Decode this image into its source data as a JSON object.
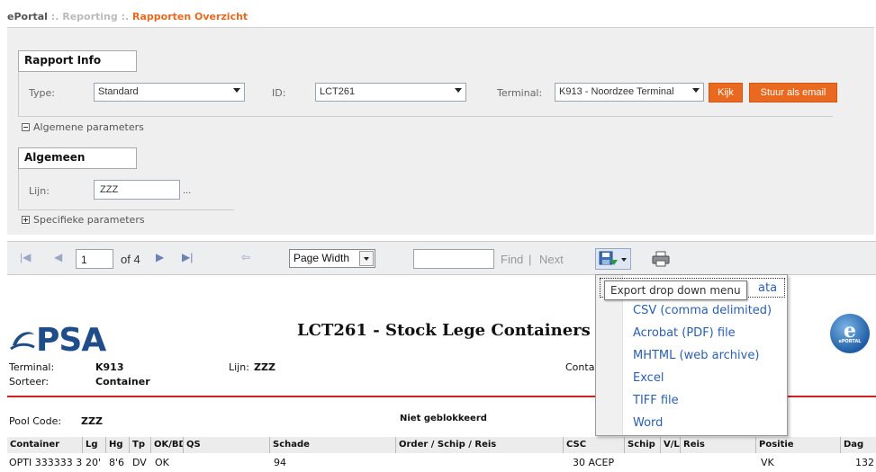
{
  "breadcrumb": {
    "home": "ePortal",
    "sep1": " :. ",
    "mid": "Reporting",
    "sep2": " :. ",
    "current": "Rapporten Overzicht"
  },
  "rapport_info": {
    "title": "Rapport Info",
    "type_label": "Type:",
    "type_value": "Standard",
    "id_label": "ID:",
    "id_value": "LCT261",
    "terminal_label": "Terminal:",
    "terminal_value": "K913 - Noordzee Terminal",
    "kijk_label": "Kijk",
    "email_label": "Stuur als email"
  },
  "algemene_toggle": "Algemene parameters",
  "algemeen": {
    "title": "Algemeen",
    "lijn_label": "Lijn:",
    "lijn_value": "ZZZ",
    "ellipsis": "..."
  },
  "specifieke_toggle": "Specifieke parameters",
  "toolbar": {
    "page_value": "1",
    "of_pages": "of 4",
    "zoom": "Page Width",
    "find_label": "Find",
    "sep": "|",
    "next_label": "Next"
  },
  "export_menu": {
    "tooltip": "Export drop down menu",
    "hidden_item_tail": "ata",
    "items": [
      "CSV (comma delimited)",
      "Acrobat (PDF) file",
      "MHTML (web archive)",
      "Excel",
      "TIFF file",
      "Word"
    ]
  },
  "report": {
    "logo_text": "PSA",
    "title": "LCT261  -  Stock Lege Containers",
    "eportal_logo_text": "e",
    "eportal_logo_sub": "ePORTAL",
    "terminal_label": "Terminal:",
    "terminal_value": "K913",
    "sorteer_label": "Sorteer:",
    "sorteer_value": "Container",
    "lijn_label": "Lijn:",
    "lijn_value": "ZZZ",
    "conta_label": "Conta",
    "pool_label": "Pool Code:",
    "pool_value": "ZZZ",
    "status": "Niet geblokkeerd"
  },
  "table": {
    "columns": [
      "Container",
      "Lg",
      "Hg",
      "Tp",
      "OK/BD",
      "QS",
      "Schade",
      "Order / Schip / Reis",
      "CSC",
      "Schip",
      "V/L",
      "Reis",
      "Positie",
      "Dag"
    ],
    "row": [
      "OPTI 333333 3",
      "20'",
      "8'6",
      "DV",
      "OK",
      "",
      "94",
      "",
      "30 ACEP",
      "",
      "",
      "",
      "VK",
      "132"
    ]
  },
  "colors": {
    "accent": "#e8691f",
    "link": "#2a5fb0",
    "brand": "#1f4d8a",
    "rule": "#d02020"
  }
}
